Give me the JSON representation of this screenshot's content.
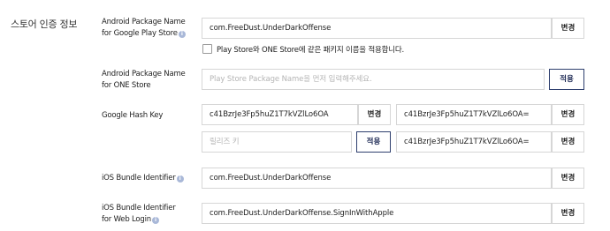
{
  "section_title": "스토어 인증 정보",
  "info_icon": "i",
  "rows": {
    "gp_package": {
      "label_line1": "Android Package Name",
      "label_line2": "for Google Play Store",
      "value": "com.FreeDust.UnderDarkOffense",
      "button": "변경",
      "checkbox_label": "Play Store와 ONE Store에 같은 패키지 이름을 적용합니다.",
      "checkbox_checked": false
    },
    "one_package": {
      "label_line1": "Android Package Name",
      "label_line2": "for ONE Store",
      "placeholder": "Play Store Package Name을 먼저 입력해주세요.",
      "button": "적용"
    },
    "hash_key": {
      "label": "Google Hash Key",
      "debug_value": "c41BzrJe3Fp5huZ1T7kVZlLo6OA",
      "debug_button": "변경",
      "debug_value_b64": "c41BzrJe3Fp5huZ1T7kVZlLo6OA=",
      "debug_button_b64": "변경",
      "release_placeholder": "릴리즈 키",
      "release_button": "적용",
      "release_value_b64": "c41BzrJe3Fp5huZ1T7kVZlLo6OA=",
      "release_button_b64": "변경"
    },
    "ios_bundle": {
      "label": "iOS Bundle Identifier",
      "value": "com.FreeDust.UnderDarkOffense",
      "button": "변경"
    },
    "ios_web": {
      "label_line1": "iOS Bundle Identifier",
      "label_line2": "for Web Login",
      "value": "com.FreeDust.UnderDarkOffense.SignInWithApple",
      "button": "변경"
    }
  }
}
